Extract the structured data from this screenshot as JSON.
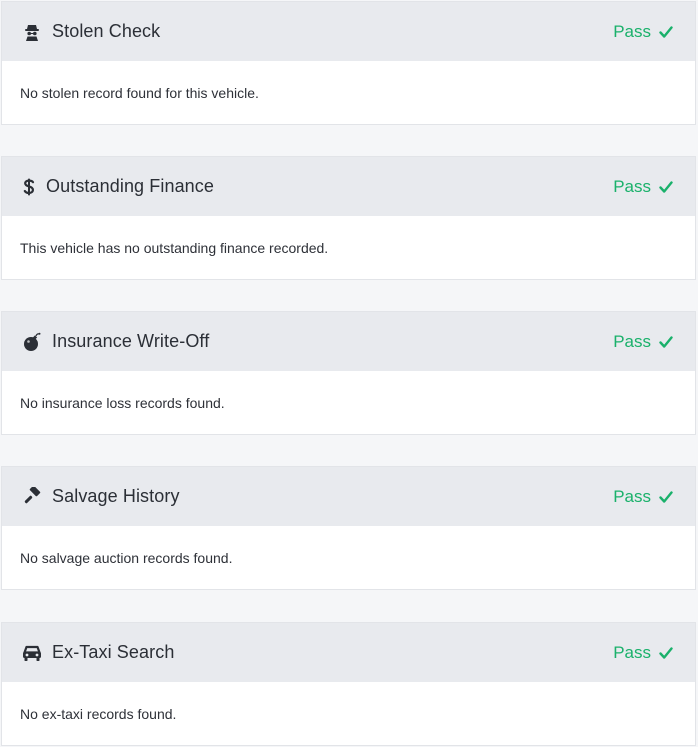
{
  "checks": [
    {
      "icon": "spy-icon",
      "title": "Stolen Check",
      "status": "Pass",
      "description": "No stolen record found for this vehicle."
    },
    {
      "icon": "dollar-icon",
      "title": "Outstanding Finance",
      "status": "Pass",
      "description": "This vehicle has no outstanding finance recorded."
    },
    {
      "icon": "bomb-icon",
      "title": "Insurance Write-Off",
      "status": "Pass",
      "description": "No insurance loss records found."
    },
    {
      "icon": "gavel-icon",
      "title": "Salvage History",
      "status": "Pass",
      "description": "No salvage auction records found."
    },
    {
      "icon": "car-icon",
      "title": "Ex-Taxi Search",
      "status": "Pass",
      "description": "No ex-taxi records found."
    }
  ],
  "colors": {
    "pass": "#1ab16b",
    "header_bg": "#e8eaee",
    "page_bg": "#f5f6f8"
  }
}
